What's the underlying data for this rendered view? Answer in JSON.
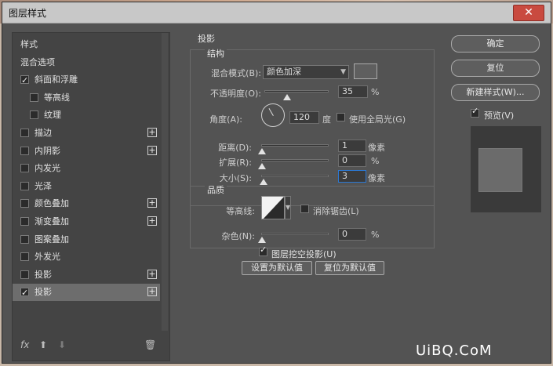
{
  "window": {
    "title": "图层样式",
    "close": "✕"
  },
  "sidebar": {
    "items": [
      {
        "label": "样式",
        "has_checkbox": false
      },
      {
        "label": "混合选项",
        "has_checkbox": false
      },
      {
        "label": "斜面和浮雕",
        "has_checkbox": true,
        "checked": true
      },
      {
        "label": "等高线",
        "has_checkbox": true,
        "checked": false,
        "indent": true
      },
      {
        "label": "纹理",
        "has_checkbox": true,
        "checked": false,
        "indent": true
      },
      {
        "label": "描边",
        "has_checkbox": true,
        "checked": false,
        "plus": true
      },
      {
        "label": "内阴影",
        "has_checkbox": true,
        "checked": false,
        "plus": true
      },
      {
        "label": "内发光",
        "has_checkbox": true,
        "checked": false
      },
      {
        "label": "光泽",
        "has_checkbox": true,
        "checked": false
      },
      {
        "label": "颜色叠加",
        "has_checkbox": true,
        "checked": false,
        "plus": true
      },
      {
        "label": "渐变叠加",
        "has_checkbox": true,
        "checked": false,
        "plus": true
      },
      {
        "label": "图案叠加",
        "has_checkbox": true,
        "checked": false
      },
      {
        "label": "外发光",
        "has_checkbox": true,
        "checked": false
      },
      {
        "label": "投影",
        "has_checkbox": true,
        "checked": false,
        "plus": true
      },
      {
        "label": "投影",
        "has_checkbox": true,
        "checked": true,
        "plus": true,
        "selected": true
      }
    ],
    "footer": {
      "fx": "fx",
      "up": "⬆",
      "down": "⬇",
      "trash": "🗑"
    }
  },
  "dropshadow": {
    "section_title": "投影",
    "structure": {
      "legend": "结构",
      "blend_mode_label": "混合模式(B):",
      "blend_mode_value": "颜色加深",
      "opacity_label": "不透明度(O):",
      "opacity_value": "35",
      "opacity_unit": "%",
      "angle_label": "角度(A):",
      "angle_value": "120",
      "angle_unit": "度",
      "global_light_label": "使用全局光(G)",
      "distance_label": "距离(D):",
      "distance_value": "1",
      "distance_unit": "像素",
      "spread_label": "扩展(R):",
      "spread_value": "0",
      "spread_unit": "%",
      "size_label": "大小(S):",
      "size_value": "3",
      "size_unit": "像素"
    },
    "quality": {
      "legend": "品质",
      "contour_label": "等高线:",
      "antialias_label": "消除锯齿(L)",
      "noise_label": "杂色(N):",
      "noise_value": "0",
      "noise_unit": "%"
    },
    "knockout_label": "图层挖空投影(U)",
    "make_default": "设置为默认值",
    "reset_default": "复位为默认值"
  },
  "actions": {
    "ok": "确定",
    "reset": "复位",
    "new_style": "新建样式(W)...",
    "preview_label": "预览(V)"
  },
  "watermark": "UiBQ.CoM",
  "colors": {
    "dialog_bg": "#535353",
    "selected_row": "#6d6d6d",
    "close": "#c94a3f"
  }
}
